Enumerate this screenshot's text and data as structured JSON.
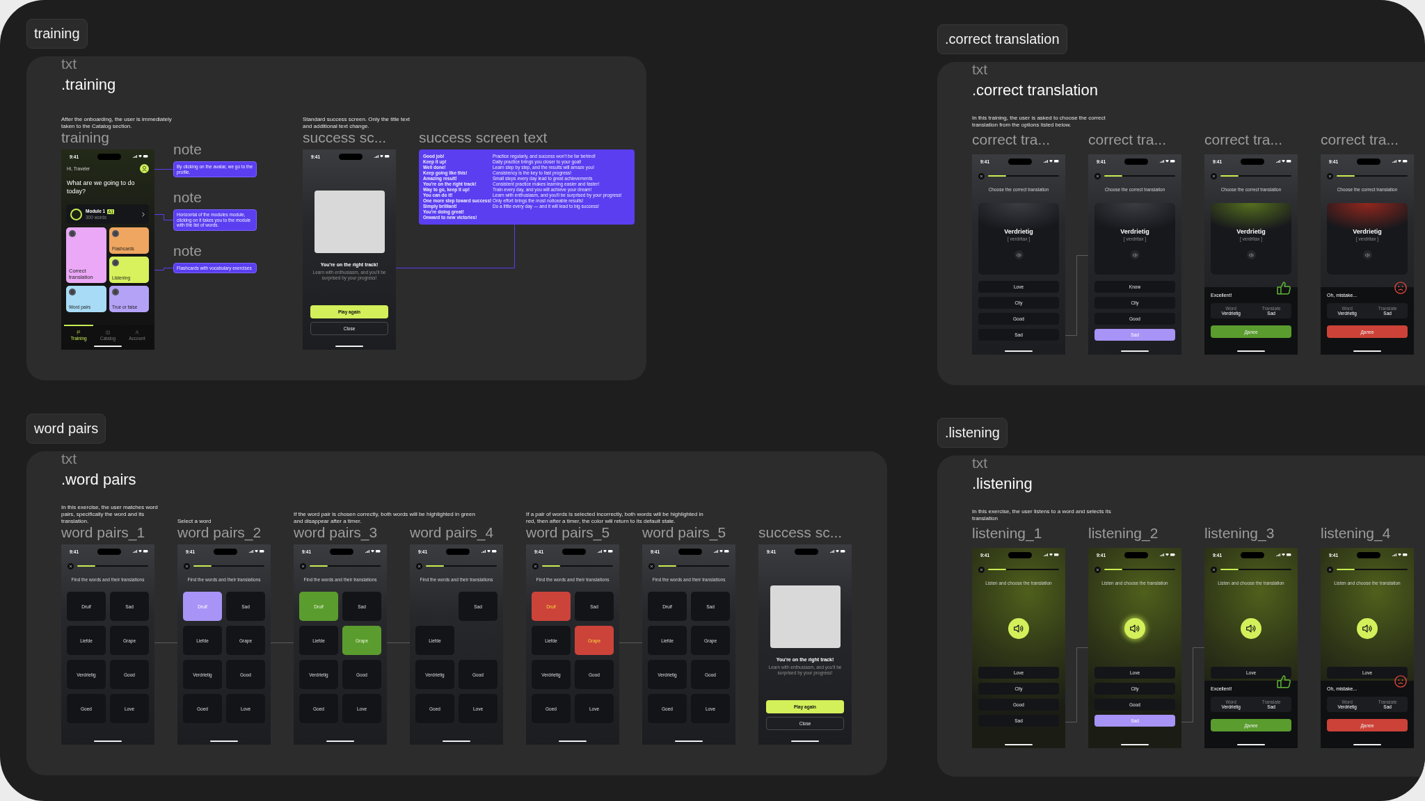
{
  "sections": [
    {
      "kind": "training",
      "tag": "training",
      "label": "txt",
      "heading": ".training",
      "home_frame": {
        "description": "After the onboarding, the user is immediately taken to the Catalog section.",
        "title": "training",
        "phone": {
          "kind": "home",
          "time": "9:41",
          "greeting": "Hi, Traveler",
          "question": "What are we going to do today?",
          "module": {
            "name": "Module 1",
            "badge": "A1",
            "words": "300 words"
          },
          "tiles": [
            {
              "label": "Correct translation",
              "color": "#eaa8f6",
              "kind": "tall"
            },
            {
              "label": "Word pairs",
              "color": "#a8dcf6",
              "kind": "small"
            },
            {
              "label": "Flashcards",
              "color": "#efa660",
              "kind": "small"
            },
            {
              "label": "Listening",
              "color": "#d7f25c",
              "kind": "small"
            },
            {
              "label": "True or false",
              "color": "#b4a2f7",
              "kind": "small"
            }
          ],
          "nav": [
            {
              "label": "Training",
              "selected": true
            },
            {
              "label": "Catalog",
              "selected": false
            },
            {
              "label": "Account",
              "selected": false
            }
          ]
        }
      },
      "notes": [
        {
          "title": "note",
          "text": "By clicking on the avatar, we go to the profile."
        },
        {
          "title": "note",
          "text": "Horizontal of the modules module, clicking on it takes you to the module with the list of words."
        },
        {
          "title": "note",
          "text": "Flashcards with vocabulary exercises"
        }
      ],
      "success_frame": {
        "description": "Standard success screen. Only the title text and additional text change.",
        "title": "success sc...",
        "phone": {
          "kind": "success",
          "time": "9:41",
          "title": "You're on the right track!",
          "text": "Learn with enthusiasm, and you'll be surprised by your progress!",
          "primary": "Play again",
          "secondary": "Close"
        }
      },
      "text_frame": {
        "title": "success screen text",
        "column_1": [
          "Good job!",
          "Keep it up!",
          "Well done!",
          "Keep going like this!",
          "Amazing result!",
          "You're on the right track!",
          "Way to go, keep it up!",
          "You can do it!",
          "One more step toward success!",
          "Simply brilliant!",
          "You're doing great!",
          "Onward to new victories!"
        ],
        "column_2": [
          "Practice regularly, and success won't be far behind!",
          "Daily practice brings you closer to your goal!",
          "Learn step by step, and the results will amaze you!",
          "Consistency is the key to fast progress!",
          "Small steps every day lead to great achievements",
          "Consistent practice makes learning easier and faster!",
          "Train every day, and you will achieve your dream!",
          "Learn with enthusiasm, and you'll be surprised by your progress!",
          "Only effort brings the most noticeable results!",
          "Do a little every day — and it will lead to big success!"
        ]
      }
    },
    {
      "kind": "translation",
      "tag": ".correct translation",
      "label": "txt",
      "heading": ".correct translation",
      "description": "In this training, the user is asked to choose the correct translation from the options listed below.",
      "frames": [
        {
          "title": "correct tra...",
          "linked": true,
          "phone": {
            "kind": "choice",
            "time": "9:41",
            "level": 0.25,
            "prompt": "Choose the correct translation",
            "word": "Verdrietig",
            "transcription": "[ verdritax ]",
            "options": [
              {
                "label": "Love",
                "selected": false
              },
              {
                "label": "City",
                "selected": false
              },
              {
                "label": "Good",
                "selected": false
              },
              {
                "label": "Sad",
                "selected": false
              }
            ]
          }
        },
        {
          "title": "correct tra...",
          "linked": false,
          "phone": {
            "kind": "choice",
            "time": "9:41",
            "level": 0.25,
            "prompt": "Choose the correct translation",
            "word": "Verdrietig",
            "transcription": "[ verdritax ]",
            "options": [
              {
                "label": "Know",
                "selected": false
              },
              {
                "label": "City",
                "selected": false
              },
              {
                "label": "Good",
                "selected": false
              },
              {
                "label": "Sad",
                "selected": true
              }
            ]
          }
        },
        {
          "title": "correct tra...",
          "linked": false,
          "phone": {
            "kind": "choice",
            "time": "9:41",
            "level": 0.25,
            "prompt": "Choose the correct translation",
            "word": "Verdrietig",
            "transcription": "[ verdritax ]",
            "result": {
              "kind": "correct",
              "title": "Excellent!",
              "word_label": "Word",
              "word": "Verdrietig",
              "translation_label": "Translate",
              "translation": "Sad",
              "button": "Далее"
            }
          }
        },
        {
          "title": "correct tra...",
          "phone": {
            "kind": "choice",
            "time": "9:41",
            "level": 0.25,
            "prompt": "Choose the correct translation",
            "word": "Verdrietig",
            "transcription": "[ verdritax ]",
            "result": {
              "kind": "wrong",
              "title": "Oh, mistake...",
              "word_label": "Word",
              "word": "Verdrietig",
              "translation_label": "Translate",
              "translation": "Sad",
              "button": "Далее"
            }
          }
        }
      ]
    },
    {
      "kind": "pairs",
      "tag": "word pairs",
      "label": "txt",
      "heading": ".word pairs",
      "frames": [
        {
          "description": "In this exercise, the user matches word pairs, specifically the word and its translation.",
          "title": "word pairs_1",
          "linked": true,
          "phone": {
            "kind": "pairs",
            "time": "9:41",
            "level": 0.25,
            "prompt": "Find the words and their translations",
            "tiles": [
              {
                "label": "Druif",
                "kind": "word",
                "selected": false
              },
              {
                "label": "Sad",
                "kind": "word",
                "selected": false
              },
              {
                "label": "Liefde",
                "kind": "word",
                "selected": false
              },
              {
                "label": "Grape",
                "kind": "word",
                "selected": false
              },
              {
                "label": "Verdrietig",
                "kind": "word",
                "selected": false
              },
              {
                "label": "Good",
                "kind": "word",
                "selected": false
              },
              {
                "label": "Goed",
                "kind": "word",
                "selected": false
              },
              {
                "label": "Love",
                "kind": "word",
                "selected": false
              }
            ]
          }
        },
        {
          "description": "Select a word",
          "title": "word pairs_2",
          "linked": true,
          "phone": {
            "kind": "pairs",
            "time": "9:41",
            "level": 0.25,
            "prompt": "Find the words and their translations",
            "tiles": [
              {
                "label": "Druif",
                "kind": "word",
                "selected": true
              },
              {
                "label": "Sad",
                "kind": "word",
                "selected": false
              },
              {
                "label": "Liefde",
                "kind": "word",
                "selected": false
              },
              {
                "label": "Grape",
                "kind": "word",
                "selected": false
              },
              {
                "label": "Verdrietig",
                "kind": "word",
                "selected": false
              },
              {
                "label": "Good",
                "kind": "word",
                "selected": false
              },
              {
                "label": "Goed",
                "kind": "word",
                "selected": false
              },
              {
                "label": "Love",
                "kind": "word",
                "selected": false
              }
            ]
          }
        },
        {
          "description": "If the word pair is chosen correctly, both words will be highlighted in green and disappear after a timer.",
          "title": "word pairs_3",
          "linked": true,
          "phone": {
            "kind": "pairs",
            "time": "9:41",
            "level": 0.25,
            "prompt": "Find the words and their translations",
            "tiles": [
              {
                "label": "Druif",
                "kind": "correct",
                "selected": false
              },
              {
                "label": "Sad",
                "kind": "word",
                "selected": false
              },
              {
                "label": "Liefde",
                "kind": "word",
                "selected": false
              },
              {
                "label": "Grape",
                "kind": "correct",
                "selected": false
              },
              {
                "label": "Verdrietig",
                "kind": "word",
                "selected": false
              },
              {
                "label": "Good",
                "kind": "word",
                "selected": false
              },
              {
                "label": "Goed",
                "kind": "word",
                "selected": false
              },
              {
                "label": "Love",
                "kind": "word",
                "selected": false
              }
            ]
          }
        },
        {
          "title": "word pairs_4",
          "linked": false,
          "phone": {
            "kind": "pairs",
            "time": "9:41",
            "level": 0.25,
            "prompt": "Find the words and their translations",
            "tiles": [
              {
                "kind": "gap"
              },
              {
                "label": "Sad",
                "kind": "word",
                "selected": false
              },
              {
                "label": "Liefde",
                "kind": "word",
                "selected": false
              },
              {
                "kind": "gap"
              },
              {
                "label": "Verdrietig",
                "kind": "word",
                "selected": false
              },
              {
                "label": "Good",
                "kind": "word",
                "selected": false
              },
              {
                "label": "Goed",
                "kind": "word",
                "selected": false
              },
              {
                "label": "Love",
                "kind": "word",
                "selected": false
              }
            ]
          }
        },
        {
          "description": "If a pair of words is selected incorrectly, both words will be highlighted in red, then after a timer, the color will return to its default state.",
          "title": "word pairs_5",
          "linked": true,
          "phone": {
            "kind": "pairs",
            "time": "9:41",
            "level": 0.25,
            "prompt": "Find the words and their translations",
            "tiles": [
              {
                "label": "Druif",
                "kind": "wrong",
                "selected": false
              },
              {
                "label": "Sad",
                "kind": "word",
                "selected": false
              },
              {
                "label": "Liefde",
                "kind": "word",
                "selected": false
              },
              {
                "label": "Grape",
                "kind": "wrong",
                "selected": false
              },
              {
                "label": "Verdrietig",
                "kind": "word",
                "selected": false
              },
              {
                "label": "Good",
                "kind": "word",
                "selected": false
              },
              {
                "label": "Goed",
                "kind": "word",
                "selected": false
              },
              {
                "label": "Love",
                "kind": "word",
                "selected": false
              }
            ]
          }
        },
        {
          "title": "word pairs_5",
          "linked": false,
          "phone": {
            "kind": "pairs",
            "time": "9:41",
            "level": 0.25,
            "prompt": "Find the words and their translations",
            "tiles": [
              {
                "label": "Druif",
                "kind": "word",
                "selected": false
              },
              {
                "label": "Sad",
                "kind": "word",
                "selected": false
              },
              {
                "label": "Liefde",
                "kind": "word",
                "selected": false
              },
              {
                "label": "Grape",
                "kind": "word",
                "selected": false
              },
              {
                "label": "Verdrietig",
                "kind": "word",
                "selected": false
              },
              {
                "label": "Good",
                "kind": "word",
                "selected": false
              },
              {
                "label": "Goed",
                "kind": "word",
                "selected": false
              },
              {
                "label": "Love",
                "kind": "word",
                "selected": false
              }
            ]
          }
        },
        {
          "title": "success sc...",
          "phone": {
            "kind": "success",
            "time": "9:41",
            "title": "You're on the right track!",
            "text": "Learn with enthusiasm, and you'll be surprised by your progress!",
            "primary": "Play again",
            "secondary": "Close"
          }
        }
      ]
    },
    {
      "kind": "listening",
      "tag": ".listening",
      "label": "txt",
      "heading": ".listening",
      "description": "In this exercise, the user listens to a word and selects its translation",
      "frames": [
        {
          "title": "listening_1",
          "linked": true,
          "phone": {
            "kind": "listen",
            "time": "9:41",
            "level": 0.25,
            "prompt": "Listen and choose the translation",
            "playing": false,
            "options": [
              {
                "label": "Love",
                "selected": false
              },
              {
                "label": "City",
                "selected": false
              },
              {
                "label": "Good",
                "selected": false
              },
              {
                "label": "Sad",
                "selected": false
              }
            ]
          }
        },
        {
          "title": "listening_2",
          "linked": true,
          "phone": {
            "kind": "listen",
            "time": "9:41",
            "level": 0.25,
            "prompt": "Listen and choose the translation",
            "playing": true,
            "options": [
              {
                "label": "Love",
                "selected": false
              },
              {
                "label": "City",
                "selected": false
              },
              {
                "label": "Good",
                "selected": false
              },
              {
                "label": "Sad",
                "selected": true
              }
            ]
          }
        },
        {
          "title": "listening_3",
          "linked": false,
          "phone": {
            "kind": "listen",
            "time": "9:41",
            "level": 0.25,
            "prompt": "Listen and choose the translation",
            "playing": false,
            "options": [
              {
                "label": "Love",
                "selected": false
              }
            ],
            "result": {
              "kind": "correct",
              "title": "Excellent!",
              "word_label": "Word",
              "word": "Verdrietig",
              "translation_label": "Translate",
              "translation": "Sad",
              "button": "Далее"
            }
          }
        },
        {
          "title": "listening_4",
          "phone": {
            "kind": "listen",
            "time": "9:41",
            "level": 0.25,
            "prompt": "Listen and choose the translation",
            "playing": false,
            "options": [
              {
                "label": "Love",
                "selected": false
              }
            ],
            "result": {
              "kind": "wrong",
              "title": "Oh, mistake...",
              "word_label": "Word",
              "word": "Verdrietig",
              "translation_label": "Translate",
              "translation": "Sad",
              "button": "Далее"
            }
          }
        }
      ]
    }
  ]
}
